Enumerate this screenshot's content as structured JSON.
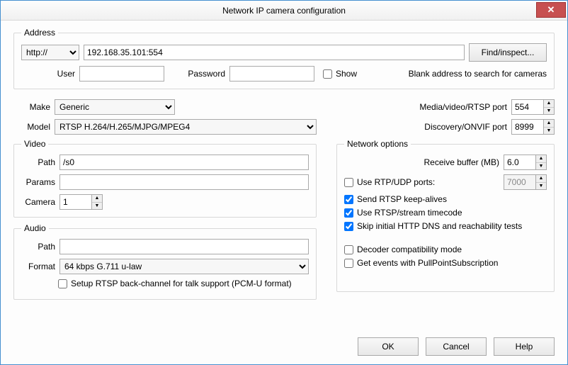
{
  "title": "Network IP camera configuration",
  "close_glyph": "✕",
  "address": {
    "legend": "Address",
    "protocol": "http://",
    "url": "192.168.35.101:554",
    "find_btn": "Find/inspect...",
    "user_label": "User",
    "user": "",
    "password_label": "Password",
    "password": "",
    "show_label": "Show",
    "hint": "Blank address to search for cameras"
  },
  "device": {
    "make_label": "Make",
    "make": "Generic",
    "model_label": "Model",
    "model": "RTSP H.264/H.265/MJPG/MPEG4",
    "rtsp_port_label": "Media/video/RTSP port",
    "rtsp_port": "554",
    "onvif_port_label": "Discovery/ONVIF port",
    "onvif_port": "8999"
  },
  "video": {
    "legend": "Video",
    "path_label": "Path",
    "path": "/s0",
    "params_label": "Params",
    "params": "",
    "camera_label": "Camera",
    "camera": "1"
  },
  "audio": {
    "legend": "Audio",
    "path_label": "Path",
    "path": "",
    "format_label": "Format",
    "format": "64 kbps G.711 u-law",
    "backchannel_label": "Setup RTSP back-channel for talk support (PCM-U format)"
  },
  "netopts": {
    "legend": "Network options",
    "buffer_label": "Receive buffer (MB)",
    "buffer": "6.0",
    "rtp_udp_label": "Use RTP/UDP ports:",
    "rtp_udp_port": "7000",
    "keepalive_label": "Send RTSP keep-alives",
    "timecode_label": "Use RTSP/stream timecode",
    "skipdns_label": "Skip initial HTTP DNS and reachability tests",
    "decoder_label": "Decoder compatibility mode",
    "pullpoint_label": "Get events with PullPointSubscription"
  },
  "footer": {
    "ok": "OK",
    "cancel": "Cancel",
    "help": "Help"
  }
}
